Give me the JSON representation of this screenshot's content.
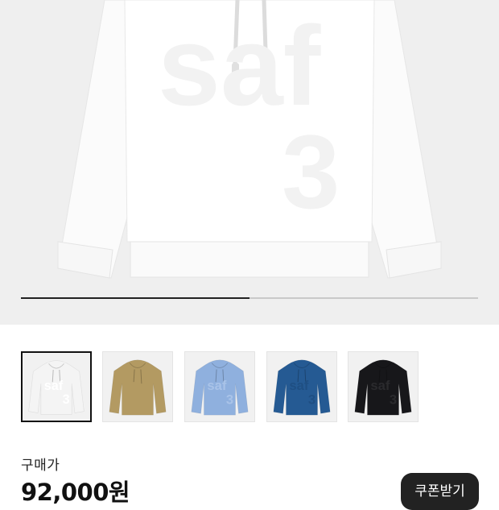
{
  "hero": {
    "image": "white-hoodie-saf3-front",
    "print_word": "saf",
    "print_number": "3",
    "progress": 0.5
  },
  "thumbnails": [
    {
      "name": "thumb-white",
      "color": "#f4f4f4",
      "print": "#ffffff",
      "print_word": "saf",
      "print_number": "3",
      "selected": true
    },
    {
      "name": "thumb-tan",
      "color": "#b39a62",
      "print": "#a68c55",
      "print_word": "",
      "print_number": "",
      "selected": false
    },
    {
      "name": "thumb-lightblue",
      "color": "#8fb0de",
      "print": "#a9c3e8",
      "print_word": "saf",
      "print_number": "3",
      "selected": false
    },
    {
      "name": "thumb-blue",
      "color": "#255a93",
      "print": "#1f4f83",
      "print_word": "saf",
      "print_number": "3",
      "selected": false
    },
    {
      "name": "thumb-black",
      "color": "#17171a",
      "print": "#2a2a2d",
      "print_word": "saf",
      "print_number": "3",
      "selected": false
    }
  ],
  "price_label": "구매가",
  "price": "92,000원",
  "coupon_button": "쿠폰받기"
}
